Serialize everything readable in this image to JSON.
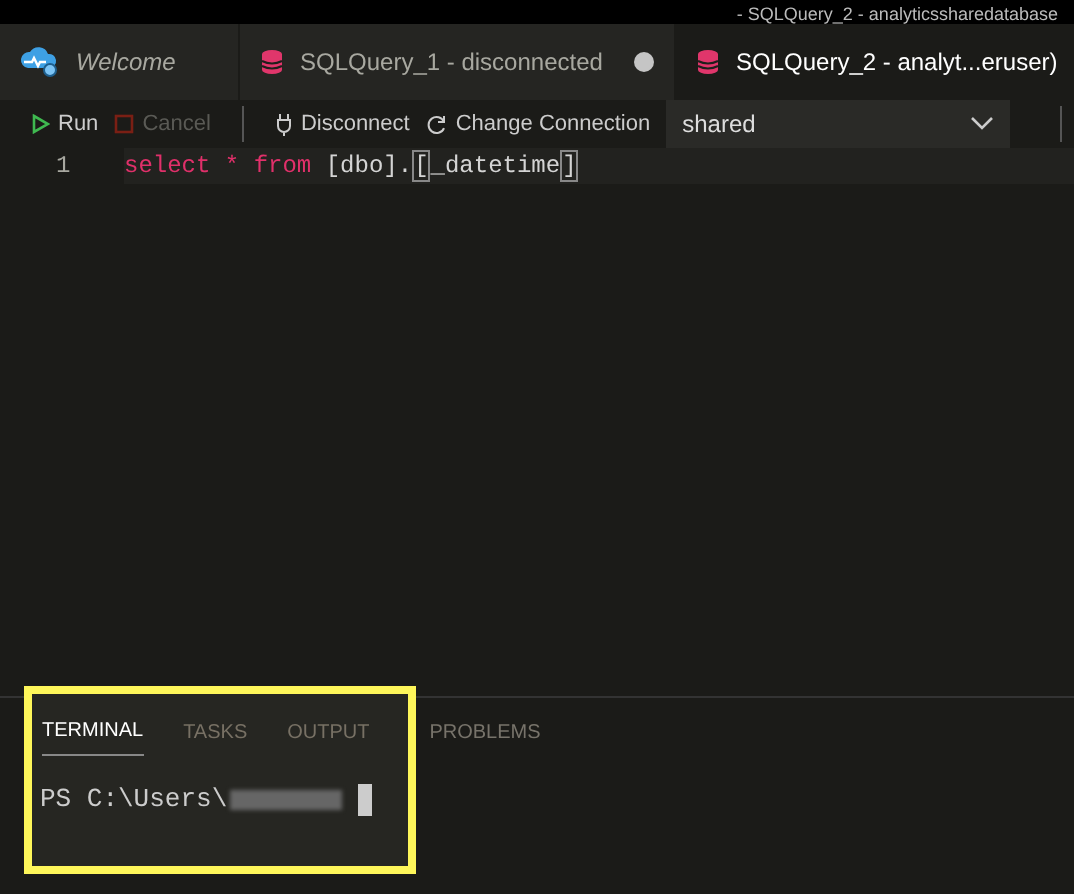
{
  "window": {
    "title": "- SQLQuery_2 - analyticssharedatabase"
  },
  "tabs": [
    {
      "label": "Welcome",
      "kind": "welcome",
      "selected": false,
      "dirty": false
    },
    {
      "label": "SQLQuery_1 - disconnected",
      "kind": "query",
      "selected": false,
      "dirty": true
    },
    {
      "label": "SQLQuery_2 - analyt...eruser)",
      "kind": "query",
      "selected": true,
      "dirty": false
    }
  ],
  "toolbar": {
    "run": {
      "label": "Run",
      "disabled": false
    },
    "cancel": {
      "label": "Cancel",
      "disabled": true
    },
    "disconnect": "Disconnect",
    "change_connection": "Change Connection",
    "database": {
      "value": "shared"
    }
  },
  "editor": {
    "lines": [
      {
        "number": "1",
        "tokens": [
          {
            "text": "select",
            "kind": "keyword"
          },
          {
            "text": " * ",
            "kind": "operator"
          },
          {
            "text": "from",
            "kind": "keyword"
          },
          {
            "text": " [dbo].",
            "kind": "plain"
          },
          {
            "text": "[",
            "kind": "bracket"
          },
          {
            "text": "_datetime",
            "kind": "plain"
          },
          {
            "text": "]",
            "kind": "bracket"
          }
        ]
      }
    ]
  },
  "panel": {
    "tabs": [
      {
        "label": "TERMINAL",
        "selected": true
      },
      {
        "label": "TASKS",
        "selected": false
      },
      {
        "label": "OUTPUT",
        "selected": false
      },
      {
        "label": "PROBLEMS",
        "selected": false
      }
    ],
    "terminal": {
      "prompt": "PS C:\\Users\\"
    }
  }
}
